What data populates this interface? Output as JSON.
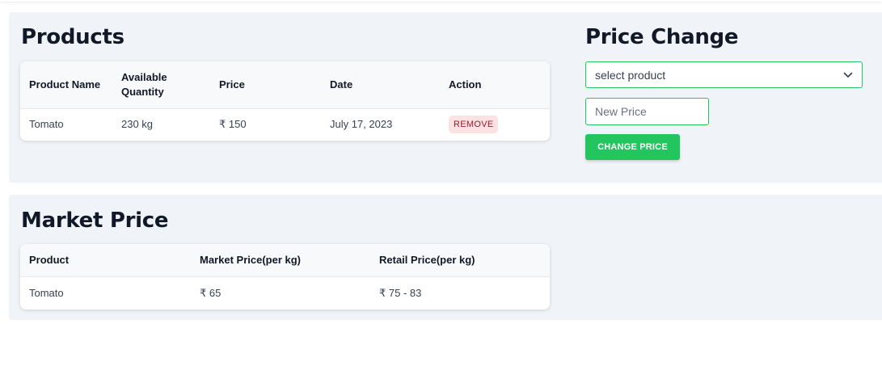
{
  "products": {
    "title": "Products",
    "columns": [
      "Product Name",
      "Available Quantity",
      "Price",
      "Date",
      "Action"
    ],
    "rows": [
      {
        "name": "Tomato",
        "quantity": "230 kg",
        "price": "₹ 150",
        "date": "July 17, 2023",
        "action": "REMOVE"
      }
    ]
  },
  "price_change": {
    "title": "Price Change",
    "select_value": "select product",
    "new_price_placeholder": "New Price",
    "button_label": "CHANGE PRICE"
  },
  "market_price": {
    "title": "Market Price",
    "columns": [
      "Product",
      "Market Price(per kg)",
      "Retail Price(per kg)"
    ],
    "rows": [
      {
        "product": "Tomato",
        "market": "₹ 65",
        "retail": "₹ 75 - 83"
      }
    ]
  },
  "colors": {
    "accent_green": "#22c55e",
    "danger_badge_bg": "#fde2e4",
    "danger_badge_text": "#9b1c2e",
    "panel_bg": "#f0f3f8"
  },
  "icons": {
    "select_chevron": "chevron-down-icon"
  }
}
